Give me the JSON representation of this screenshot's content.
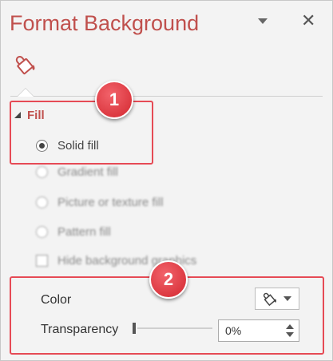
{
  "pane": {
    "title": "Format Background"
  },
  "colors": {
    "accent": "#c0504d",
    "callout": "#e64a55"
  },
  "icons": {
    "pin": "chevron-down-icon",
    "close": "close-icon",
    "tab": "paint-bucket-icon",
    "color": "paint-bucket-icon"
  },
  "fill": {
    "heading": "Fill",
    "options": [
      {
        "label": "Solid fill",
        "selected": true
      },
      {
        "label": "Gradient fill",
        "selected": false
      },
      {
        "label": "Picture or texture fill",
        "selected": false
      },
      {
        "label": "Pattern fill",
        "selected": false
      }
    ],
    "hide_graphics": {
      "label": "Hide background graphics",
      "checked": false
    }
  },
  "color": {
    "label": "Color"
  },
  "transparency": {
    "label": "Transparency",
    "value": "0%",
    "level": 0
  },
  "callouts": [
    "1",
    "2"
  ]
}
